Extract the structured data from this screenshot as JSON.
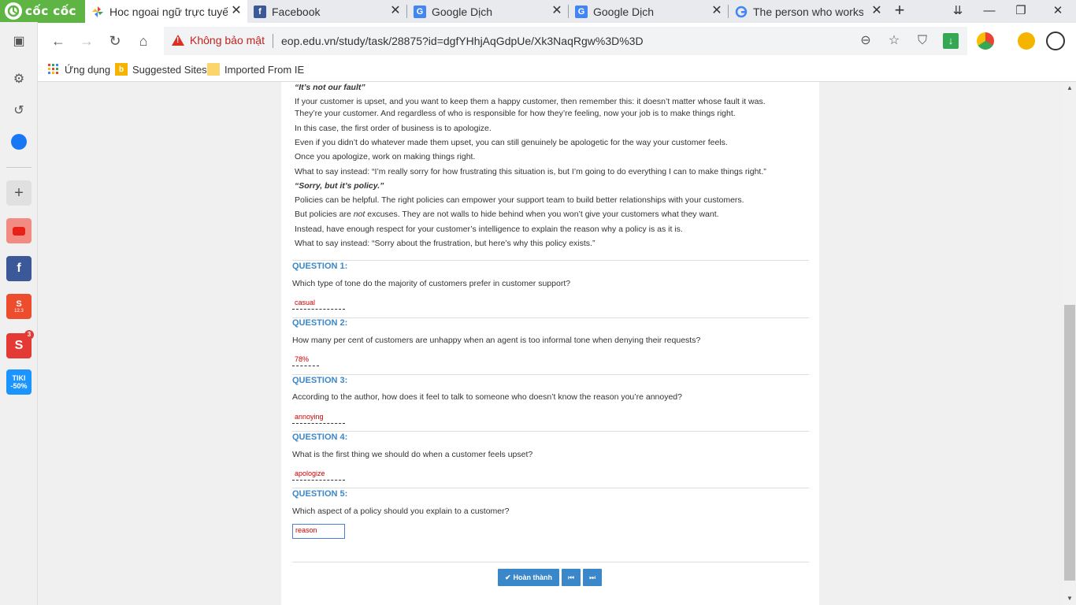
{
  "browser": {
    "brand": "cốc cốc",
    "tabs": [
      {
        "title": "Hoc ngoai ngữ trực tuyế",
        "favicon": "coccoc-pinwheel-icon",
        "active": true
      },
      {
        "title": "Facebook",
        "favicon": "facebook-icon",
        "active": false
      },
      {
        "title": "Google Dịch",
        "favicon": "google-translate-icon",
        "active": false
      },
      {
        "title": "Google Dịch",
        "favicon": "google-translate-icon",
        "active": false
      },
      {
        "title": "The person who works",
        "favicon": "google-icon",
        "active": false
      }
    ],
    "security_label": "Không bảo mật",
    "url": "eop.edu.vn/study/task/28875?id=dgfYHhjAqGdpUe/Xk3NaqRgw%3D%3D",
    "bookmarks": [
      {
        "label": "Ứng dụng",
        "icon": "apps-grid-icon"
      },
      {
        "label": "Suggested Sites",
        "icon": "bing-icon"
      },
      {
        "label": "Imported From IE",
        "icon": "folder-icon"
      }
    ],
    "sidebar_badge": "3",
    "sidebar_tiki": "TIKI -50%",
    "shopee_sub": "12.3"
  },
  "article": {
    "lines": [
      {
        "text": "“It’s not our fault”",
        "bold": true
      },
      {
        "text": "If your customer is upset, and you want to keep them a happy customer, then remember this: it doesn’t matter whose fault it was."
      },
      {
        "text": "They’re your customer. And regardless of who is responsible for how they’re feeling, now your job is to make things right."
      },
      {
        "text": "In this case, the first order of business is to apologize."
      },
      {
        "text": "Even if you didn’t do whatever made them upset, you can still genuinely be apologetic for the way your customer feels."
      },
      {
        "text": "Once you apologize, work on making things right."
      },
      {
        "text": "What to say instead: “I’m really sorry for how frustrating this situation is, but I’m going to do everything I can to make things right.”"
      },
      {
        "text": "“Sorry, but it’s policy.”",
        "bold": true
      },
      {
        "text": "Policies can be helpful. The right policies can empower your support team to build better relationships with your customers."
      },
      {
        "text_before": "But policies are ",
        "text_italic": "not",
        "text_after": " excuses. They are not walls to hide behind when you won’t give your customers what they want."
      },
      {
        "text": "Instead, have enough respect for your customer’s intelligence to explain the reason why a policy is as it is."
      },
      {
        "text": "What to say instead: “Sorry about the frustration, but here’s why this policy exists.”"
      }
    ]
  },
  "questions": [
    {
      "title": "QUESTION 1:",
      "text": "Which type of tone do the majority of customers prefer in customer support?",
      "answer": "casual"
    },
    {
      "title": "QUESTION 2:",
      "text": "How many per cent of customers are unhappy when an agent is too informal tone when denying their requests?",
      "answer": "78%"
    },
    {
      "title": "QUESTION 3:",
      "text": "According to the author, how does it feel to talk to someone who doesn’t know the reason you’re annoyed?",
      "answer": "annoying"
    },
    {
      "title": "QUESTION 4:",
      "text": "What is the first thing we should do when a customer feels upset?",
      "answer": "apologize"
    },
    {
      "title": "QUESTION 5:",
      "text": "Which aspect of a policy should you explain to a customer?",
      "answer": "reason"
    }
  ],
  "footer": {
    "finish_label": "Hoàn thành",
    "prev_icon": "skip-back-icon",
    "next_icon": "skip-forward-icon"
  },
  "colors": {
    "accent": "#3a87c9",
    "answer_text": "#cc0000",
    "warning": "#d93025",
    "brand_green": "#5fb544"
  }
}
